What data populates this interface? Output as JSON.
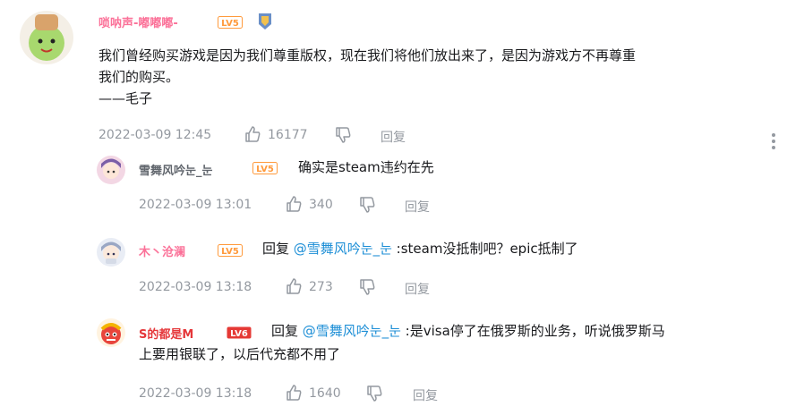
{
  "colors": {
    "name_pink": "#fb7299",
    "name_red": "#e5373a",
    "meta_gray": "#9499a0",
    "at_blue": "#1c8ed6",
    "lv5": "#ff9a3c",
    "lv6": "#e53935"
  },
  "main_comment": {
    "user": "唢呐声-嘟嘟嘟-",
    "level": "LV5",
    "lines": [
      "我们曾经购买游戏是因为我们尊重版权，现在我们将他们放出来了，是因为游戏方不再尊重",
      "我们的购买。",
      "——毛子"
    ],
    "time": "2022-03-09 12:45",
    "likes": "16177",
    "reply_label": "回复"
  },
  "replies": [
    {
      "user": "雪舞风吟눈_눈",
      "level": "LV5",
      "text": "确实是steam违约在先",
      "time": "2022-03-09 13:01",
      "likes": "340",
      "reply_label": "回复"
    },
    {
      "user": "木丶沧澜",
      "level": "LV5",
      "prefix": "回复 ",
      "at": "@雪舞风吟눈_눈",
      "text": " :steam没抵制吧？epic抵制了",
      "time": "2022-03-09 13:18",
      "likes": "273",
      "reply_label": "回复"
    },
    {
      "user": "S的都是M",
      "level": "LV6",
      "prefix": "回复 ",
      "at": "@雪舞风吟눈_눈",
      "text": " :是visa停了在俄罗斯的业务，听说俄罗斯马",
      "line2": "上要用银联了，以后代充都不用了",
      "time": "2022-03-09 13:18",
      "likes": "1640",
      "reply_label": "回复"
    }
  ],
  "icons": {
    "like": "thumbs-up-icon",
    "dislike": "thumbs-down-icon",
    "more": "more-vertical-icon",
    "badge": "medal-badge-icon"
  }
}
